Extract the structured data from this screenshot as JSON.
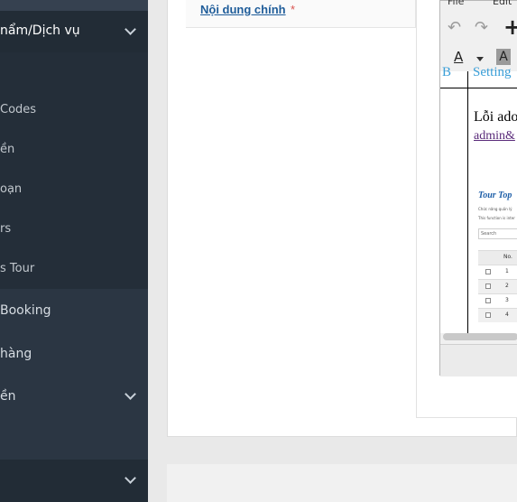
{
  "sidebar": {
    "section_top": {
      "label": "nẩm/Dịch vụ"
    },
    "sub_items": [
      {
        "label": "Codes"
      },
      {
        "label": "ền"
      },
      {
        "label": "oạn"
      },
      {
        "label": "rs"
      },
      {
        "label": "s Tour"
      }
    ],
    "main_items": [
      {
        "label": "Booking"
      },
      {
        "label": "hàng"
      },
      {
        "label": "ền"
      }
    ]
  },
  "main": {
    "field_label": "Nội dung chính",
    "required_mark": "*"
  },
  "editor": {
    "menu": [
      "File",
      "Edit"
    ],
    "toolbar": {
      "undo_glyph": "↶",
      "redo_glyph": "↷",
      "add_glyph": "+",
      "text_color_glyph": "A",
      "bg_color_glyph": "A"
    },
    "doc": {
      "cell_b": "B",
      "cell_settings": "Setting",
      "error_text": "Lỗi ado",
      "link_text": "admin&"
    },
    "thumbnail": {
      "title": "Tour Top",
      "line1": "Chức năng quản lý",
      "line2": "This function is inter",
      "search_placeholder": "Search",
      "col_no": "No.",
      "rows": [
        "1",
        "2",
        "3",
        "4"
      ]
    }
  },
  "colors": {
    "sidebar_bg": "#2b3643",
    "link_blue": "#1f5d9a",
    "required_red": "#d9534f",
    "settings_blue": "#3a9fd8"
  }
}
